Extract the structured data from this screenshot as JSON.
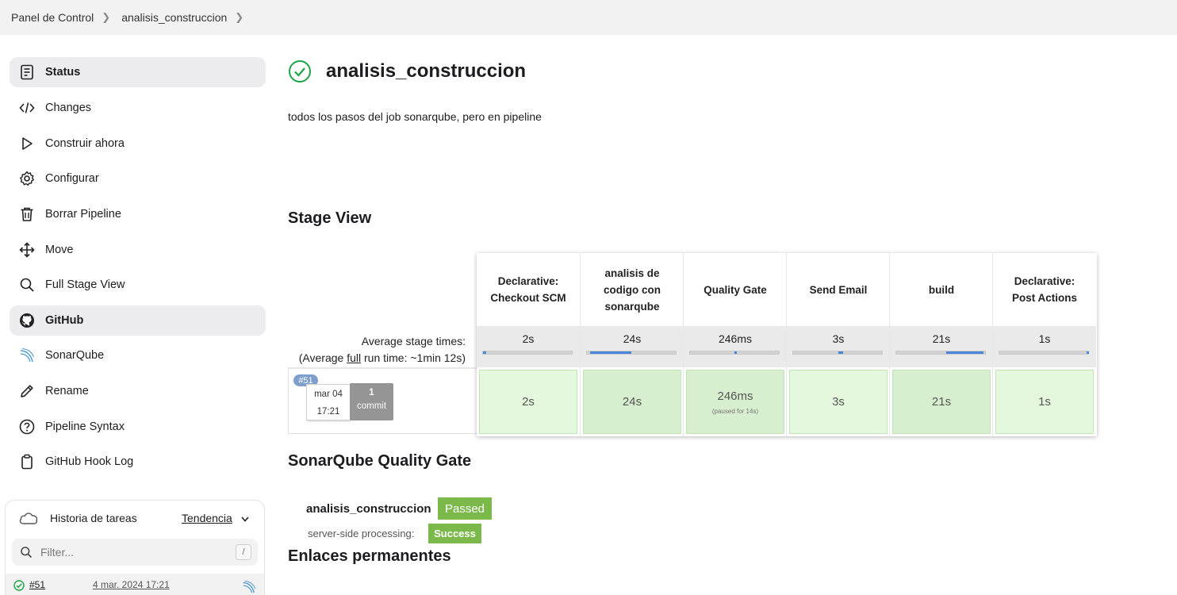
{
  "breadcrumb": {
    "items": [
      "Panel de Control",
      "analisis_construccion"
    ]
  },
  "sidebar": {
    "items": [
      {
        "label": "Status",
        "icon": "document-icon"
      },
      {
        "label": "Changes",
        "icon": "code-icon"
      },
      {
        "label": "Construir ahora",
        "icon": "play-icon"
      },
      {
        "label": "Configurar",
        "icon": "gear-icon"
      },
      {
        "label": "Borrar Pipeline",
        "icon": "trash-icon"
      },
      {
        "label": "Move",
        "icon": "move-icon"
      },
      {
        "label": "Full Stage View",
        "icon": "search-icon"
      },
      {
        "label": "GitHub",
        "icon": "github-icon"
      },
      {
        "label": "SonarQube",
        "icon": "sonarqube-icon"
      },
      {
        "label": "Rename",
        "icon": "pencil-icon"
      },
      {
        "label": "Pipeline Syntax",
        "icon": "help-icon"
      },
      {
        "label": "GitHub Hook Log",
        "icon": "clipboard-icon"
      }
    ],
    "active": [
      "Status",
      "GitHub"
    ]
  },
  "history": {
    "title": "Historia de tareas",
    "trend_label": "Tendencia",
    "filter_placeholder": "Filter...",
    "filter_shortcut": "/",
    "builds": [
      {
        "number": "#51",
        "date": "4 mar. 2024 17:21"
      }
    ]
  },
  "job": {
    "title": "analisis_construccion",
    "description": "todos los pasos del job sonarqube, pero en pipeline",
    "status_color": "#1ea446"
  },
  "stage_view": {
    "heading": "Stage View",
    "avg_label_line1": "Average stage times:",
    "avg_label_line2_pre": "(Average ",
    "avg_label_line2_link": "full",
    "avg_label_line2_post": " run time: ~1min 12s)",
    "stages": [
      {
        "name": "Declarative:\nCheckout SCM",
        "avg": "2s",
        "cell": "2s",
        "note": "",
        "bar_start": 0.0,
        "bar_frac": 0.04
      },
      {
        "name": "analisis de\ncodigo con\nsonarqube",
        "avg": "24s",
        "cell": "24s",
        "note": "",
        "bar_start": 0.04,
        "bar_frac": 0.46
      },
      {
        "name": "Quality Gate",
        "avg": "246ms",
        "cell": "246ms",
        "note": "(paused for 14s)",
        "bar_start": 0.5,
        "bar_frac": 0.01
      },
      {
        "name": "Send Email",
        "avg": "3s",
        "cell": "3s",
        "note": "",
        "bar_start": 0.51,
        "bar_frac": 0.05
      },
      {
        "name": "build",
        "avg": "21s",
        "cell": "21s",
        "note": "",
        "bar_start": 0.56,
        "bar_frac": 0.42
      },
      {
        "name": "Declarative:\nPost Actions",
        "avg": "1s",
        "cell": "1s",
        "note": "",
        "bar_start": 0.98,
        "bar_frac": 0.02
      }
    ],
    "run": {
      "badge": "#51",
      "date": "mar 04",
      "time": "17:21",
      "commits_count": "1",
      "commits_label": "commit"
    }
  },
  "sonar": {
    "heading": "SonarQube Quality Gate",
    "project": "analisis_construccion",
    "status": "Passed",
    "processing_label": "server-side processing:",
    "processing_status": "Success",
    "accent": "#7cb94b"
  },
  "permalinks": {
    "heading": "Enlaces permanentes"
  }
}
